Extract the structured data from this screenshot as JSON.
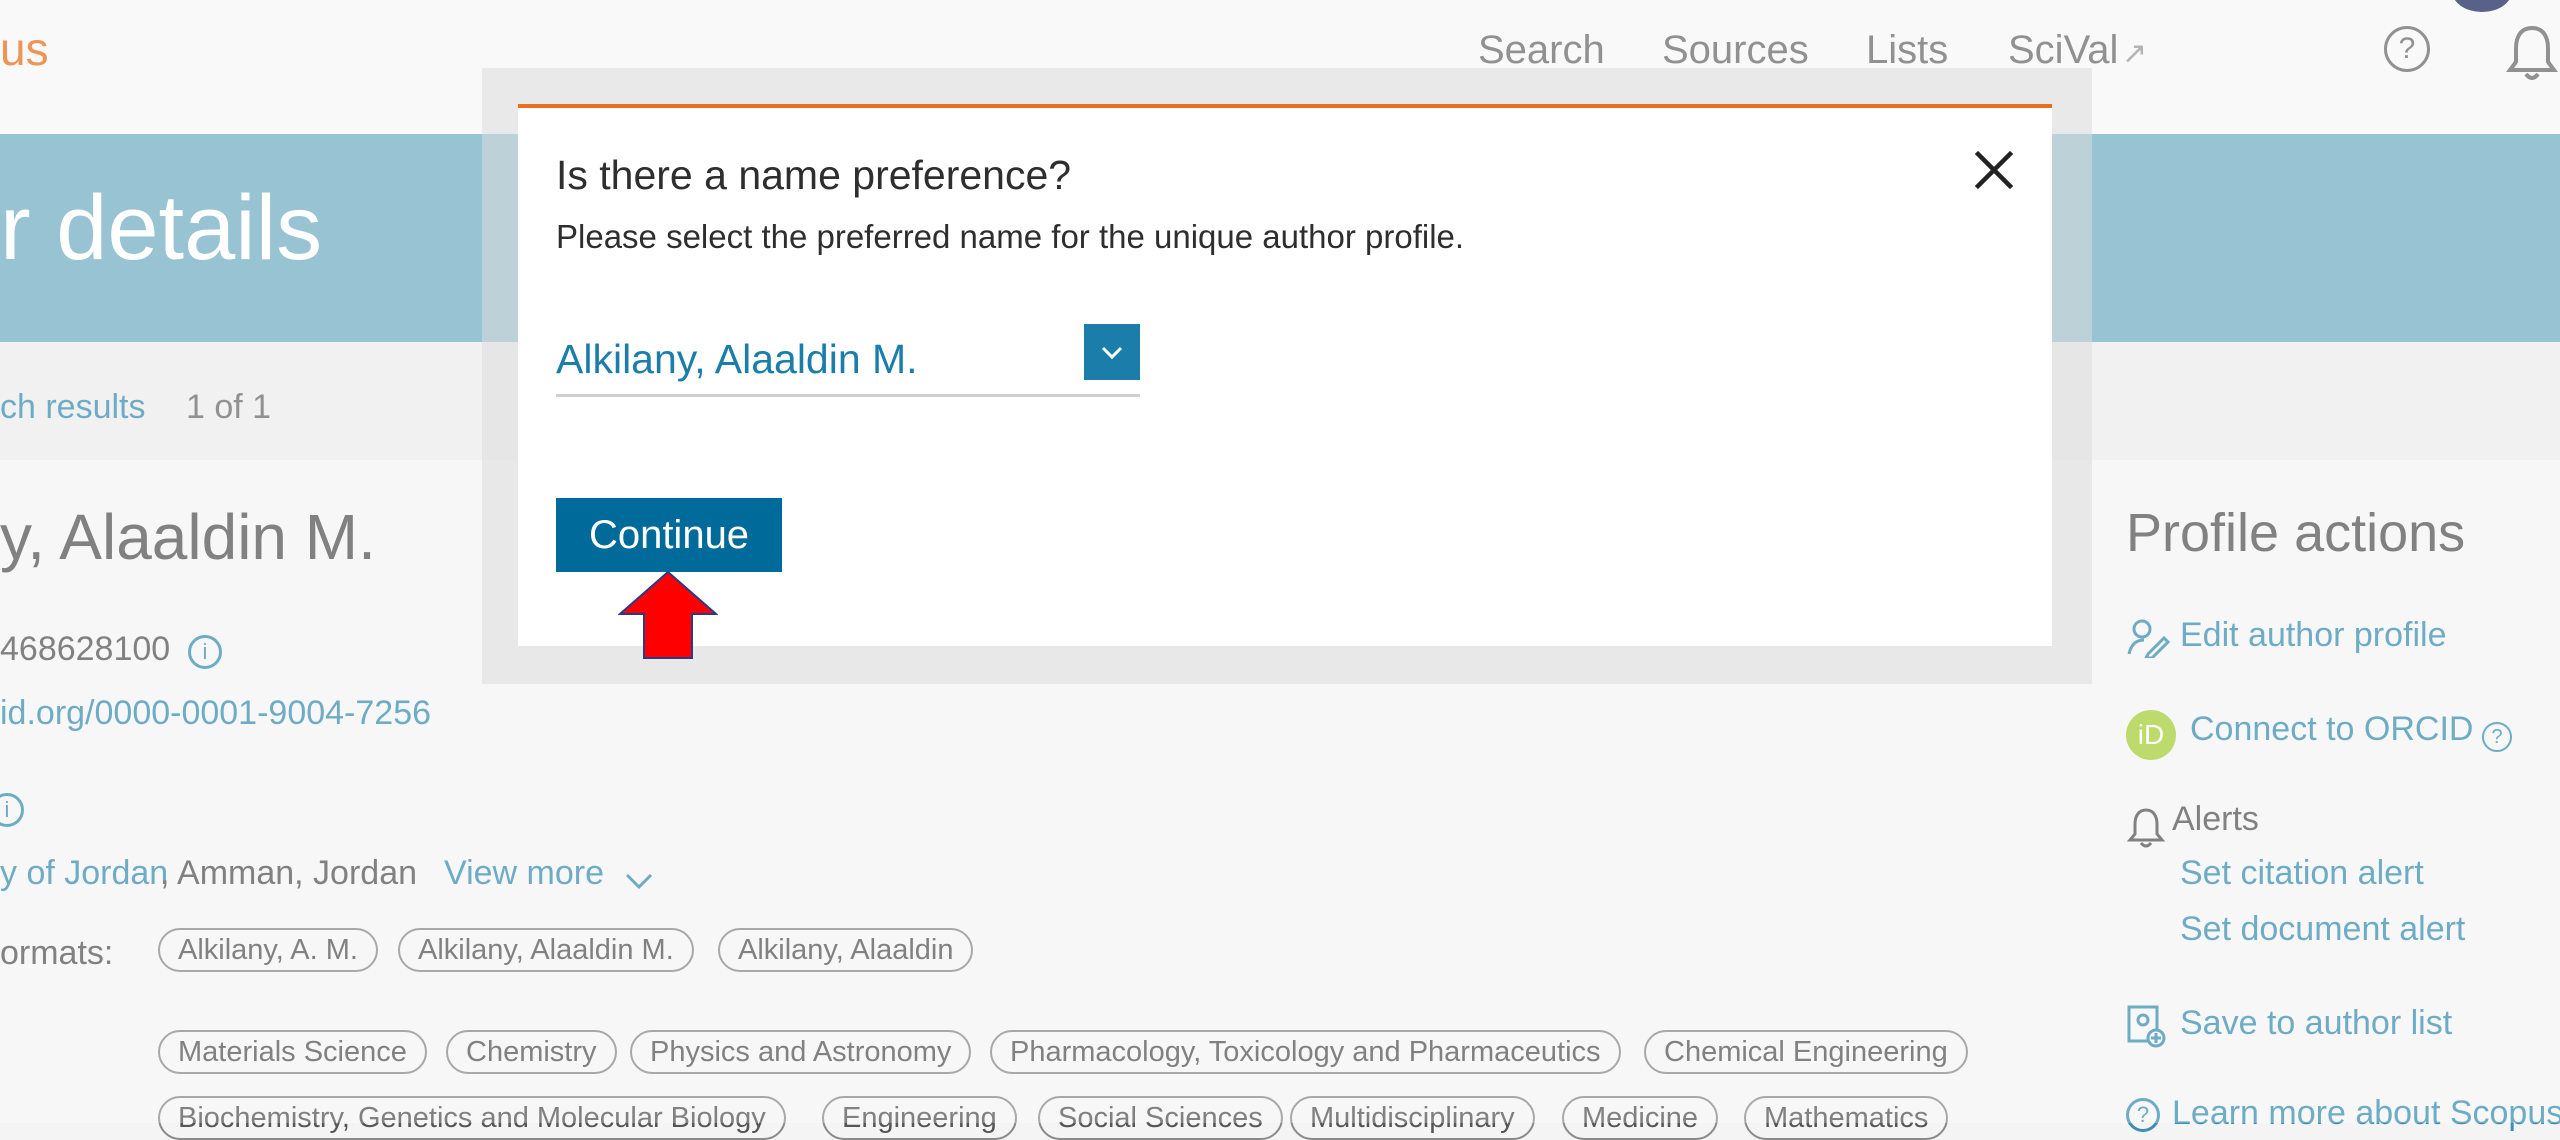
{
  "header": {
    "logo_text": "us",
    "nav": {
      "search": "Search",
      "sources": "Sources",
      "lists": "Lists",
      "scival": "SciVal",
      "scival_arrow": "↗"
    },
    "help_glyph": "?"
  },
  "banner": {
    "title": "r details"
  },
  "breadcrumb": {
    "back_label": "ch results",
    "count": "1 of 1"
  },
  "author": {
    "name": "y, Alaaldin M.",
    "id": "468628100",
    "orcid_url": "id.org/0000-0001-9004-7256",
    "affiliation_org": "y of Jordan",
    "affiliation_location": ", Amman, Jordan",
    "view_more": "View more",
    "formats_label": "ormats:",
    "name_formats": [
      "Alkilany, A. M.",
      "Alkilany, Alaaldin M.",
      "Alkilany, Alaaldin"
    ],
    "subject_areas": [
      "Materials Science",
      "Chemistry",
      "Physics and Astronomy",
      "Pharmacology, Toxicology and Pharmaceutics",
      "Chemical Engineering"
    ],
    "subject_areas_row2": [
      "Biochemistry, Genetics and Molecular Biology",
      "Engineering",
      "Social Sciences",
      "Multidisciplinary",
      "Medicine",
      "Mathematics"
    ]
  },
  "profile_actions": {
    "title": "Profile actions",
    "edit_profile": "Edit author profile",
    "orcid_badge": "iD",
    "connect_orcid": "Connect to ORCID",
    "alerts": "Alerts",
    "set_citation_alert": "Set citation alert",
    "set_document_alert": "Set document alert",
    "save_to_list": "Save to author list",
    "learn_more": "Learn more about Scopus"
  },
  "modal": {
    "title": "Is there a name preference?",
    "subtitle": "Please select the preferred name for the unique author profile.",
    "selected_name": "Alkilany, Alaaldin M.",
    "continue_label": "Continue"
  },
  "colors": {
    "accent_orange": "#e9711c",
    "banner_teal": "#73afc4",
    "link_blue": "#3c8fb3",
    "button_blue": "#006b9a",
    "annotation_red": "#ff0000"
  },
  "icons": [
    "help-icon",
    "bell-icon",
    "info-icon",
    "chevron-down-icon",
    "close-icon",
    "edit-profile-icon",
    "orcid-icon",
    "bell-alert-icon",
    "save-list-icon",
    "red-arrow-annotation-icon"
  ]
}
